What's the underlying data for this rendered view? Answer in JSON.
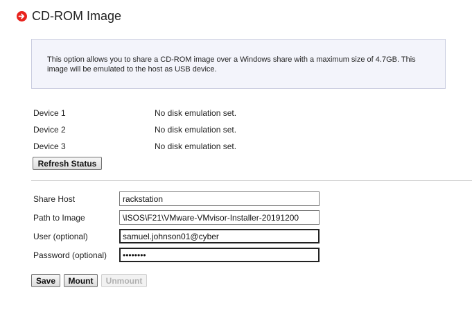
{
  "header": {
    "title": "CD-ROM Image",
    "icon": "arrow-right-circle-icon"
  },
  "info": "This option allows you to share a CD-ROM image over a Windows share with a maximum size of 4.7GB. This image will be emulated to the host as USB device.",
  "devices": [
    {
      "label": "Device 1",
      "status": "No disk emulation set."
    },
    {
      "label": "Device 2",
      "status": "No disk emulation set."
    },
    {
      "label": "Device 3",
      "status": "No disk emulation set."
    }
  ],
  "refresh_label": "Refresh Status",
  "form": {
    "share_host": {
      "label": "Share Host",
      "value": "rackstation"
    },
    "path": {
      "label": "Path to Image",
      "value": "\\ISOS\\F21\\VMware-VMvisor-Installer-20191200"
    },
    "user": {
      "label": "User (optional)",
      "value": "samuel.johnson01@cyber"
    },
    "password": {
      "label": "Password (optional)",
      "value": "••••••••"
    }
  },
  "buttons": {
    "save": "Save",
    "mount": "Mount",
    "unmount": "Unmount"
  },
  "colors": {
    "accent": "#e8231d",
    "info_bg": "#f3f4fb"
  }
}
